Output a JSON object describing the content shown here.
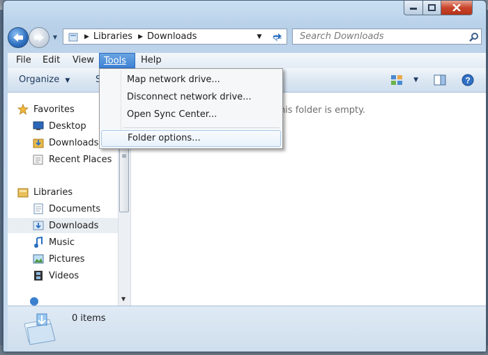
{
  "window": {
    "title": "Downloads"
  },
  "address": {
    "crumbs": [
      "Libraries",
      "Downloads"
    ]
  },
  "search": {
    "placeholder": "Search Downloads"
  },
  "menubar": {
    "items": [
      {
        "label": "File"
      },
      {
        "label": "Edit"
      },
      {
        "label": "View"
      },
      {
        "label": "Tools"
      },
      {
        "label": "Help"
      }
    ]
  },
  "cmdbar": {
    "organize": "Organize",
    "share_peek": "S"
  },
  "tools_menu": {
    "items": [
      {
        "label": "Map network drive..."
      },
      {
        "label": "Disconnect network drive..."
      },
      {
        "label": "Open Sync Center..."
      },
      {
        "label": "Folder options..."
      }
    ]
  },
  "nav": {
    "favorites": {
      "label": "Favorites",
      "items": [
        "Desktop",
        "Downloads",
        "Recent Places"
      ]
    },
    "libraries": {
      "label": "Libraries",
      "items": [
        "Documents",
        "Downloads",
        "Music",
        "Pictures",
        "Videos"
      ]
    },
    "selected": "Downloads"
  },
  "content": {
    "empty_message": "This folder is empty."
  },
  "details": {
    "item_count": "0 items"
  },
  "colors": {
    "accent": "#3e82d4",
    "close": "#c9452b",
    "folder": "#e8b94a"
  }
}
